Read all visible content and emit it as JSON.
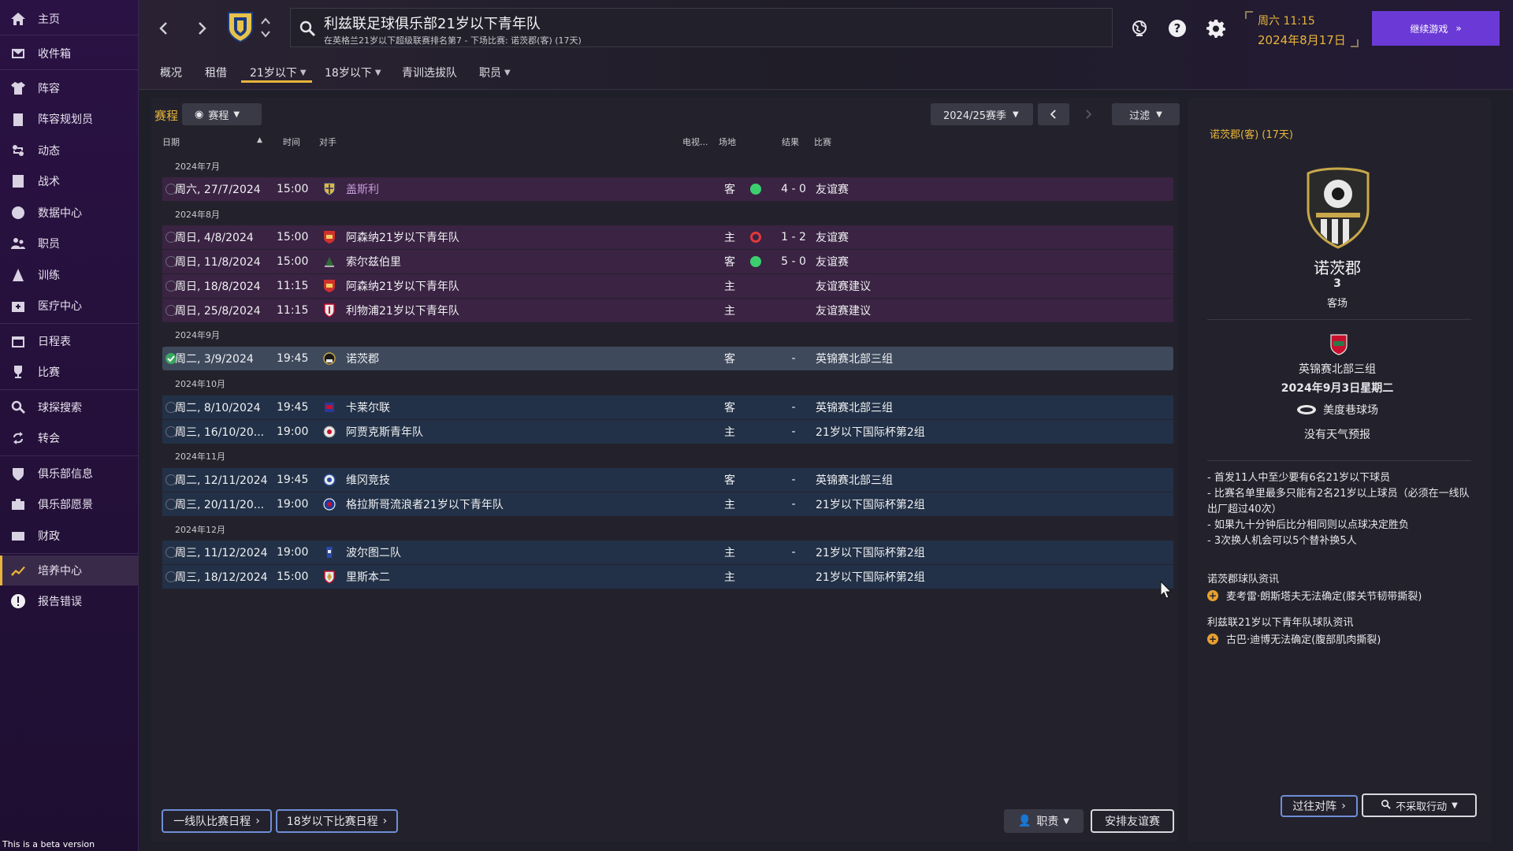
{
  "sidebar": {
    "items": [
      {
        "label": "主页",
        "icon": "home-icon"
      },
      {
        "label": "收件箱",
        "icon": "inbox-icon"
      },
      {
        "label": "阵容",
        "icon": "shirt-icon"
      },
      {
        "label": "阵容规划员",
        "icon": "clipboard-icon"
      },
      {
        "label": "动态",
        "icon": "dynamics-icon"
      },
      {
        "label": "战术",
        "icon": "tactics-icon"
      },
      {
        "label": "数据中心",
        "icon": "data-hub-icon"
      },
      {
        "label": "职员",
        "icon": "staff-icon"
      },
      {
        "label": "训练",
        "icon": "training-icon"
      },
      {
        "label": "医疗中心",
        "icon": "medical-icon"
      },
      {
        "label": "日程表",
        "icon": "calendar-icon"
      },
      {
        "label": "比赛",
        "icon": "trophy-icon"
      },
      {
        "label": "球探搜索",
        "icon": "search-icon"
      },
      {
        "label": "转会",
        "icon": "transfer-icon"
      },
      {
        "label": "俱乐部信息",
        "icon": "shield-icon"
      },
      {
        "label": "俱乐部愿景",
        "icon": "vision-icon"
      },
      {
        "label": "财政",
        "icon": "finance-icon"
      },
      {
        "label": "培养中心",
        "icon": "development-icon"
      },
      {
        "label": "报告错误",
        "icon": "alert-icon"
      }
    ],
    "beta_text": "This is a beta version"
  },
  "header": {
    "title": "利兹联足球俱乐部21岁以下青年队",
    "subtitle": "在英格兰21岁以下超级联赛排名第7 - 下场比赛: 诺茨郡(客) (17天)",
    "day_time": "周六 11:15",
    "date": "2024年8月17日",
    "continue_label": "继续游戏"
  },
  "tabs": [
    {
      "label": "概况",
      "dropdown": false
    },
    {
      "label": "租借",
      "dropdown": false
    },
    {
      "label": "21岁以下",
      "dropdown": true
    },
    {
      "label": "18岁以下",
      "dropdown": true
    },
    {
      "label": "青训选拔队",
      "dropdown": false
    },
    {
      "label": "职员",
      "dropdown": true
    }
  ],
  "toolbar": {
    "section_label": "赛程",
    "view_label": "赛程",
    "season_label": "2024/25赛季",
    "filter_label": "过滤"
  },
  "columns": {
    "date": "日期",
    "time": "时间",
    "opponent": "对手",
    "tv": "电视...",
    "venue": "场地",
    "result": "结果",
    "competition": "比赛"
  },
  "months": [
    "2024年7月",
    "2024年8月",
    "2024年9月",
    "2024年10月",
    "2024年11月",
    "2024年12月"
  ],
  "fixtures": [
    {
      "date": "周六, 27/7/2024",
      "time": "15:00",
      "opponent": "盖斯利",
      "venue": "客",
      "result": "win",
      "score": "4 - 0",
      "competition": "友谊赛",
      "type": "friendly",
      "done": false,
      "link": true
    },
    {
      "date": "周日, 4/8/2024",
      "time": "15:00",
      "opponent": "阿森纳21岁以下青年队",
      "venue": "主",
      "result": "loss",
      "score": "1 - 2",
      "competition": "友谊赛",
      "type": "friendly",
      "done": false
    },
    {
      "date": "周日, 11/8/2024",
      "time": "15:00",
      "opponent": "索尔兹伯里",
      "venue": "客",
      "result": "win",
      "score": "5 - 0",
      "competition": "友谊赛",
      "type": "friendly",
      "done": false
    },
    {
      "date": "周日, 18/8/2024",
      "time": "11:15",
      "opponent": "阿森纳21岁以下青年队",
      "venue": "主",
      "result": "",
      "score": "",
      "competition": "友谊赛建议",
      "type": "friendly",
      "done": false
    },
    {
      "date": "周日, 25/8/2024",
      "time": "11:15",
      "opponent": "利物浦21岁以下青年队",
      "venue": "主",
      "result": "",
      "score": "",
      "competition": "友谊赛建议",
      "type": "friendly",
      "done": false
    },
    {
      "date": "周二, 3/9/2024",
      "time": "19:45",
      "opponent": "诺茨郡",
      "venue": "客",
      "result": "",
      "score": "-",
      "competition": "英锦赛北部三组",
      "type": "selected",
      "done": true
    },
    {
      "date": "周二, 8/10/2024",
      "time": "19:45",
      "opponent": "卡莱尔联",
      "venue": "客",
      "result": "",
      "score": "-",
      "competition": "英锦赛北部三组",
      "type": "league",
      "done": false
    },
    {
      "date": "周三, 16/10/20...",
      "time": "19:00",
      "opponent": "阿贾克斯青年队",
      "venue": "主",
      "result": "",
      "score": "-",
      "competition": "21岁以下国际杯第2组",
      "type": "league",
      "done": false
    },
    {
      "date": "周二, 12/11/2024",
      "time": "19:45",
      "opponent": "维冈竞技",
      "venue": "客",
      "result": "",
      "score": "-",
      "competition": "英锦赛北部三组",
      "type": "league",
      "done": false
    },
    {
      "date": "周三, 20/11/20...",
      "time": "19:00",
      "opponent": "格拉斯哥流浪者21岁以下青年队",
      "venue": "主",
      "result": "",
      "score": "-",
      "competition": "21岁以下国际杯第2组",
      "type": "league",
      "done": false
    },
    {
      "date": "周三, 11/12/2024",
      "time": "19:00",
      "opponent": "波尔图二队",
      "venue": "主",
      "result": "",
      "score": "-",
      "competition": "21岁以下国际杯第2组",
      "type": "league",
      "done": false
    },
    {
      "date": "周三, 18/12/2024",
      "time": "15:00",
      "opponent": "里斯本二",
      "venue": "主",
      "result": "",
      "score": "",
      "competition": "21岁以下国际杯第2组",
      "type": "league",
      "done": false
    }
  ],
  "bottom_buttons": {
    "first_team": "一线队比赛日程",
    "u18": "18岁以下比赛日程",
    "staff": "职责",
    "arrange": "安排友谊赛"
  },
  "right_panel": {
    "header": "诺茨郡(客) (17天)",
    "team": "诺茨郡",
    "position": "3",
    "venue": "客场",
    "competition": "英锦赛北部三组",
    "date": "2024年9月3日星期二",
    "stadium": "美度巷球场",
    "weather": "没有天气预报",
    "rules": [
      "- 首发11人中至少要有6名21岁以下球员",
      "- 比赛名单里最多只能有2名21岁以上球员（必须在一线队出厂超过40次）",
      "- 如果九十分钟后比分相同则以点球决定胜负",
      "- 3次换人机会可以5个替补换5人"
    ],
    "opp_news_title": "诺茨郡球队资讯",
    "opp_news_item": "麦考雷·朗斯塔夫无法确定(膝关节韧带撕裂)",
    "own_news_title": "利兹联21岁以下青年队球队资讯",
    "own_news_item": "古巴·迪博无法确定(腹部肌肉撕裂)",
    "past_btn": "过往对阵",
    "no_action_btn": "不采取行动"
  },
  "colors": {
    "accent": "#e8b53a",
    "friendly_row": "#3a2343",
    "league_row": "#223147",
    "win": "#3ccf70",
    "loss": "#e03a3a",
    "continue": "#6b3ad6"
  }
}
